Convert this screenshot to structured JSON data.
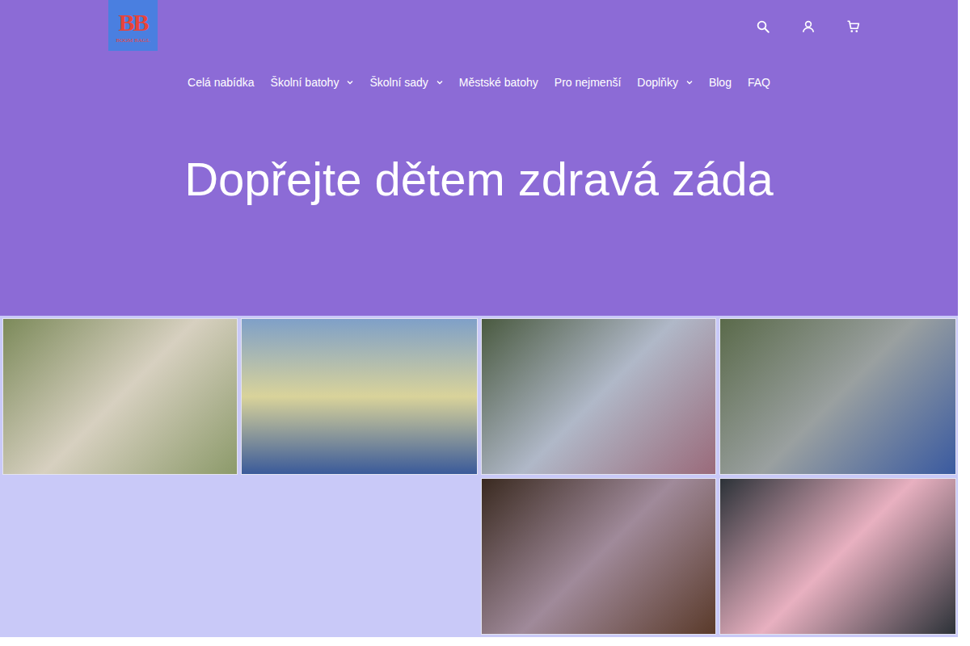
{
  "logo": {
    "mark": "BB",
    "name": "BOOM BAGL"
  },
  "header_icons": [
    "search",
    "account",
    "cart"
  ],
  "nav": [
    {
      "label": "Celá nabídka",
      "dropdown": false
    },
    {
      "label": "Školní batohy",
      "dropdown": true
    },
    {
      "label": "Školní sady",
      "dropdown": true
    },
    {
      "label": "Městské batohy",
      "dropdown": false
    },
    {
      "label": "Pro nejmenší",
      "dropdown": false
    },
    {
      "label": "Doplňky",
      "dropdown": true
    },
    {
      "label": "Blog",
      "dropdown": false
    },
    {
      "label": "FAQ",
      "dropdown": false
    }
  ],
  "hero": {
    "title": "Dopřejte dětem zdravá záda"
  },
  "tiles": [
    "category-1-5",
    "student-backpacks",
    "for-little-ones",
    "accessories",
    "value-sets",
    "frii-retro-infographic"
  ]
}
